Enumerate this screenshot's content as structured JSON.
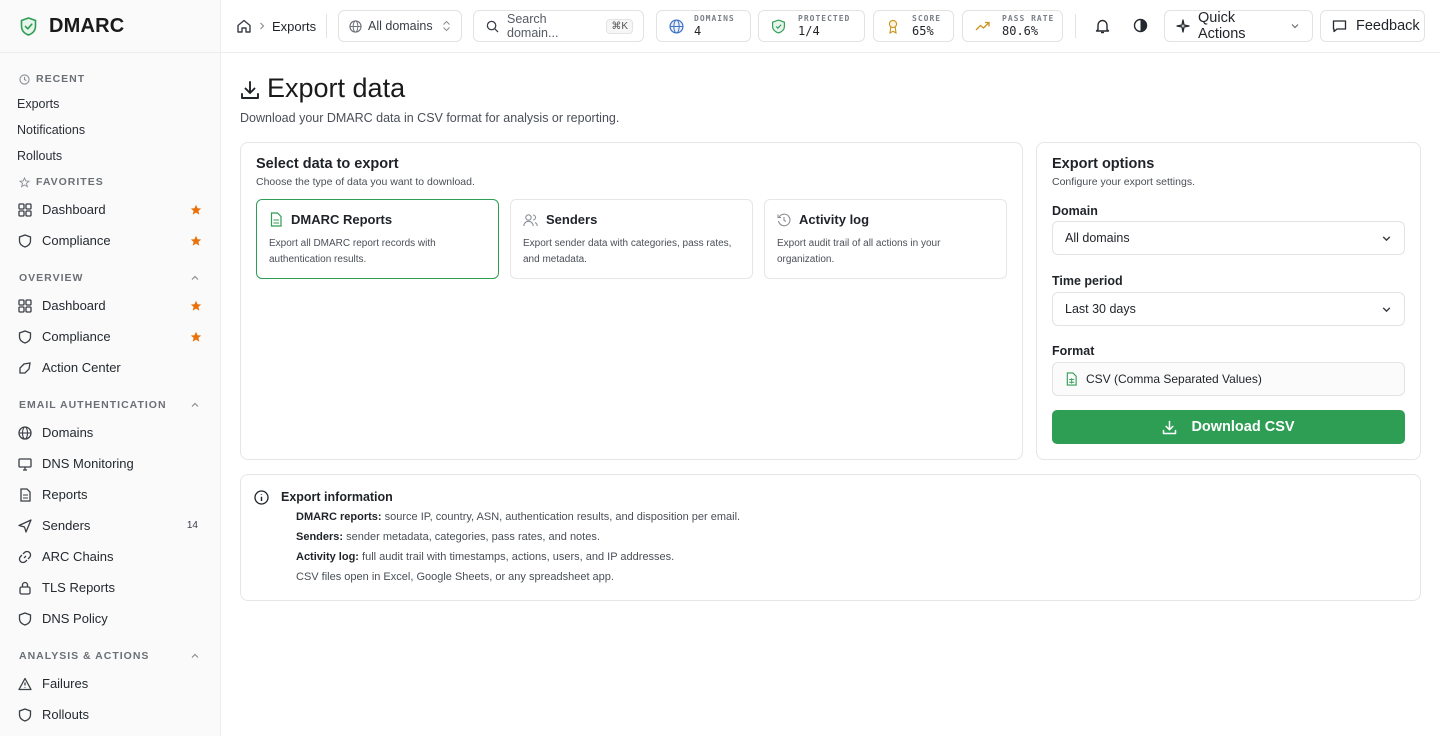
{
  "brand": {
    "name": "DMARC"
  },
  "sidebar": {
    "recent": {
      "title": "Recent",
      "items": [
        {
          "label": "Exports"
        },
        {
          "label": "Notifications"
        },
        {
          "label": "Rollouts"
        }
      ]
    },
    "favorites": {
      "title": "Favorites",
      "items": [
        {
          "label": "Dashboard",
          "icon": "dashboard-icon"
        },
        {
          "label": "Compliance",
          "icon": "compliance-icon"
        }
      ]
    },
    "overview": {
      "title": "Overview",
      "items": [
        {
          "label": "Dashboard",
          "icon": "dashboard-icon",
          "starred": true
        },
        {
          "label": "Compliance",
          "icon": "compliance-icon",
          "starred": true
        },
        {
          "label": "Action Center",
          "icon": "action-center-icon"
        }
      ]
    },
    "email_auth": {
      "title": "Email Authentication",
      "items": [
        {
          "label": "Domains",
          "icon": "globe-icon"
        },
        {
          "label": "DNS Monitoring",
          "icon": "monitor-icon"
        },
        {
          "label": "Reports",
          "icon": "report-icon"
        },
        {
          "label": "Senders",
          "icon": "send-icon",
          "count": "14"
        },
        {
          "label": "ARC Chains",
          "icon": "link-icon"
        },
        {
          "label": "TLS Reports",
          "icon": "lock-icon"
        },
        {
          "label": "DNS Policy",
          "icon": "shield-icon"
        }
      ]
    },
    "analysis": {
      "title": "Analysis & Actions",
      "items": [
        {
          "label": "Failures",
          "icon": "warning-icon"
        },
        {
          "label": "Rollouts",
          "icon": "shield-icon"
        }
      ]
    }
  },
  "topbar": {
    "breadcrumb": "Exports",
    "domain_select": "All domains",
    "search_placeholder": "Search domain...",
    "search_shortcut": "⌘K",
    "stats": [
      {
        "label": "Domains",
        "value": "4"
      },
      {
        "label": "Protected",
        "value": "1/4"
      },
      {
        "label": "Score",
        "value": "65%"
      },
      {
        "label": "Pass rate",
        "value": "80.6%"
      }
    ],
    "quick_actions": "Quick Actions",
    "feedback": "Feedback"
  },
  "page": {
    "title": "Export data",
    "subtitle": "Download your DMARC data in CSV format for analysis or reporting."
  },
  "select_card": {
    "title": "Select data to export",
    "subtitle": "Choose the type of data you want to download.",
    "options": [
      {
        "title": "DMARC Reports",
        "desc": "Export all DMARC report records with authentication results.",
        "selected": true
      },
      {
        "title": "Senders",
        "desc": "Export sender data with categories, pass rates, and metadata.",
        "selected": false
      },
      {
        "title": "Activity log",
        "desc": "Export audit trail of all actions in your organization.",
        "selected": false
      }
    ]
  },
  "options_card": {
    "title": "Export options",
    "subtitle": "Configure your export settings.",
    "domain_label": "Domain",
    "domain_value": "All domains",
    "period_label": "Time period",
    "period_value": "Last 30 days",
    "format_label": "Format",
    "format_value": "CSV (Comma Separated Values)",
    "download_label": "Download CSV"
  },
  "info": {
    "title": "Export information",
    "lines": [
      {
        "term": "DMARC reports:",
        "text": "source IP, country, ASN, authentication results, and disposition per email."
      },
      {
        "term": "Senders:",
        "text": "sender metadata, categories, pass rates, and notes."
      },
      {
        "term": "Activity log:",
        "text": "full audit trail with timestamps, actions, users, and IP addresses."
      },
      {
        "term": "",
        "text": "CSV files open in Excel, Google Sheets, or any spreadsheet app."
      }
    ]
  },
  "colors": {
    "accent": "#2f9e55",
    "star": "#e8710a"
  }
}
